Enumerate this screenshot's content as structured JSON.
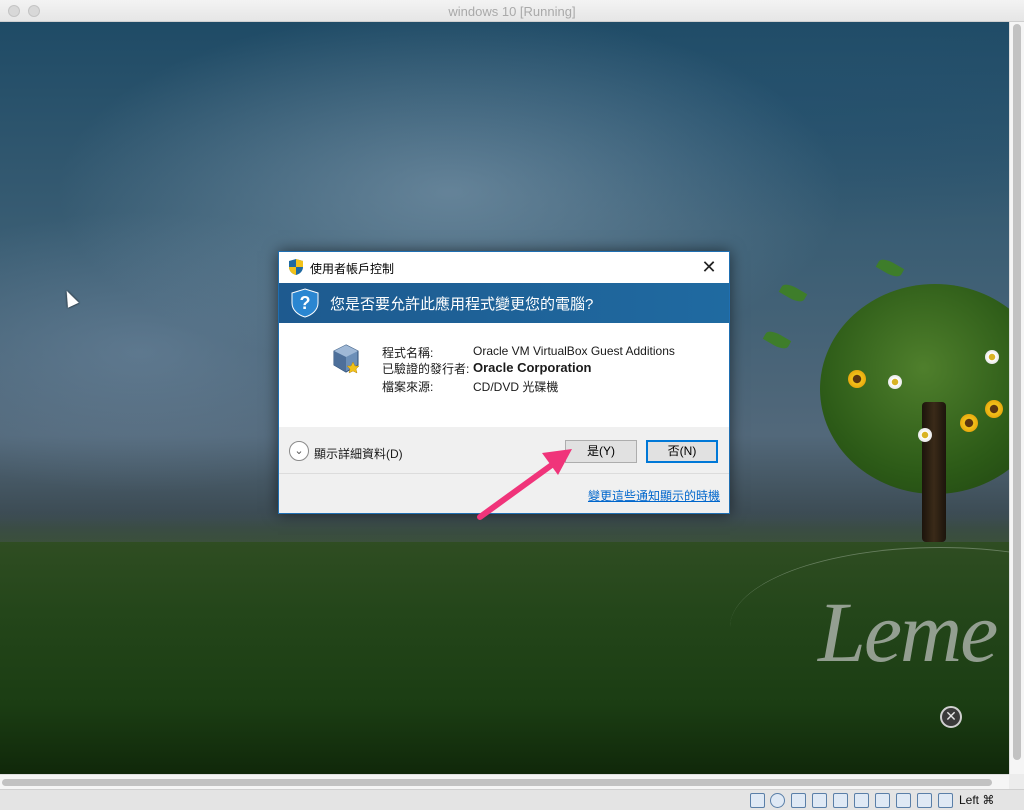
{
  "window": {
    "title": "windows 10 [Running]"
  },
  "desktop": {
    "logo_text": "Leme"
  },
  "uac": {
    "dialog_title": "使用者帳戶控制",
    "question": "您是否要允許此應用程式變更您的電腦?",
    "program_label": "程式名稱:",
    "program_value": "Oracle VM VirtualBox Guest Additions",
    "publisher_label": "已驗證的發行者:",
    "publisher_value": "Oracle Corporation",
    "source_label": "檔案來源:",
    "source_value": "CD/DVD 光碟機",
    "details_label": "顯示詳細資料(D)",
    "yes_label": "是(Y)",
    "no_label": "否(N)",
    "notify_link": "變更這些通知顯示的時機"
  },
  "statusbar": {
    "icons": [
      "hard-disk-icon",
      "optical-drive-icon",
      "network-icon",
      "usb-icon",
      "shared-folders-icon",
      "display-icon",
      "video-capture-icon",
      "recording-icon",
      "mouse-integration-icon",
      "keyboard-icon"
    ],
    "host_key": "Left ⌘"
  },
  "colors": {
    "accent": "#1f6aa1",
    "arrow": "#f0347a",
    "link": "#0066cc"
  }
}
